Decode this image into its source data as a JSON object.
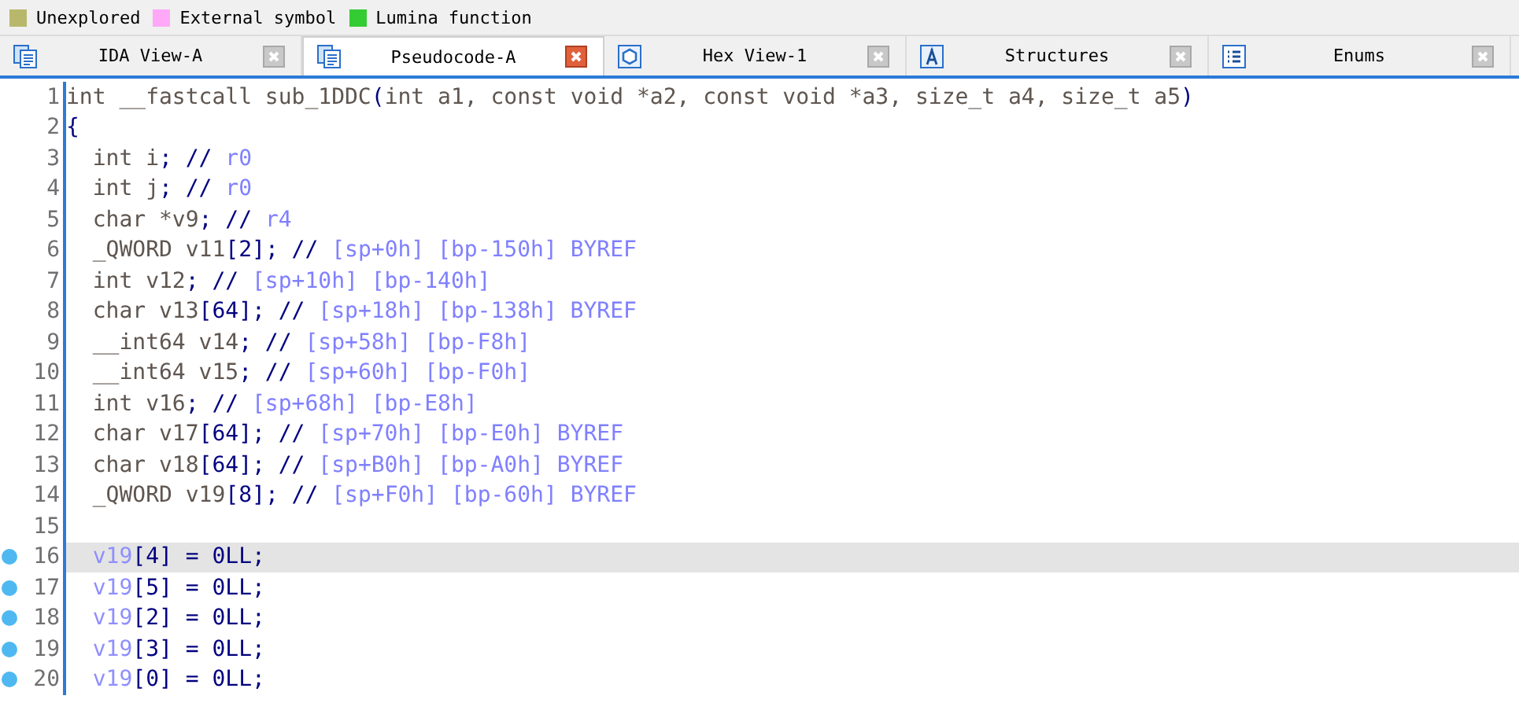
{
  "legend": [
    {
      "label": "Unexplored",
      "color": "#b8b86c"
    },
    {
      "label": "External symbol",
      "color": "#ffa8f8"
    },
    {
      "label": "Lumina function",
      "color": "#33cc33"
    }
  ],
  "tabs": [
    {
      "label": "IDA View-A",
      "kind": "listing",
      "selected": false
    },
    {
      "label": "Pseudocode-A",
      "kind": "listing",
      "selected": true
    },
    {
      "label": "Hex View-1",
      "kind": "hex",
      "selected": false
    },
    {
      "label": "Structures",
      "kind": "struct",
      "selected": false
    },
    {
      "label": "Enums",
      "kind": "enum",
      "selected": false
    }
  ],
  "lines": [
    {
      "number": "1",
      "breakpoint": false,
      "highlighted": false,
      "tokens": [
        {
          "kind": "plain",
          "text": "int __fastcall sub_1DDC"
        },
        {
          "kind": "punct",
          "text": "("
        },
        {
          "kind": "plain",
          "text": "int a1, const void *a2, const void *a3, size_t a4, size_t a5"
        },
        {
          "kind": "punct",
          "text": ")"
        }
      ]
    },
    {
      "number": "2",
      "breakpoint": false,
      "highlighted": false,
      "tokens": [
        {
          "kind": "punct",
          "text": "{"
        }
      ]
    },
    {
      "number": "3",
      "breakpoint": false,
      "highlighted": false,
      "tokens": [
        {
          "kind": "plain",
          "text": "  int i"
        },
        {
          "kind": "punct",
          "text": "; //"
        },
        {
          "kind": "comment",
          "text": " r0"
        }
      ]
    },
    {
      "number": "4",
      "breakpoint": false,
      "highlighted": false,
      "tokens": [
        {
          "kind": "plain",
          "text": "  int j"
        },
        {
          "kind": "punct",
          "text": "; //"
        },
        {
          "kind": "comment",
          "text": " r0"
        }
      ]
    },
    {
      "number": "5",
      "breakpoint": false,
      "highlighted": false,
      "tokens": [
        {
          "kind": "plain",
          "text": "  char *v9"
        },
        {
          "kind": "punct",
          "text": "; //"
        },
        {
          "kind": "comment",
          "text": " r4"
        }
      ]
    },
    {
      "number": "6",
      "breakpoint": false,
      "highlighted": false,
      "tokens": [
        {
          "kind": "plain",
          "text": "  _QWORD v11"
        },
        {
          "kind": "punct",
          "text": "[2]; //"
        },
        {
          "kind": "comment",
          "text": " [sp+0h] [bp-150h] BYREF"
        }
      ]
    },
    {
      "number": "7",
      "breakpoint": false,
      "highlighted": false,
      "tokens": [
        {
          "kind": "plain",
          "text": "  int v12"
        },
        {
          "kind": "punct",
          "text": "; //"
        },
        {
          "kind": "comment",
          "text": " [sp+10h] [bp-140h]"
        }
      ]
    },
    {
      "number": "8",
      "breakpoint": false,
      "highlighted": false,
      "tokens": [
        {
          "kind": "plain",
          "text": "  char v13"
        },
        {
          "kind": "punct",
          "text": "[64]; //"
        },
        {
          "kind": "comment",
          "text": " [sp+18h] [bp-138h] BYREF"
        }
      ]
    },
    {
      "number": "9",
      "breakpoint": false,
      "highlighted": false,
      "tokens": [
        {
          "kind": "plain",
          "text": "  __int64 v14"
        },
        {
          "kind": "punct",
          "text": "; //"
        },
        {
          "kind": "comment",
          "text": " [sp+58h] [bp-F8h]"
        }
      ]
    },
    {
      "number": "10",
      "breakpoint": false,
      "highlighted": false,
      "tokens": [
        {
          "kind": "plain",
          "text": "  __int64 v15"
        },
        {
          "kind": "punct",
          "text": "; //"
        },
        {
          "kind": "comment",
          "text": " [sp+60h] [bp-F0h]"
        }
      ]
    },
    {
      "number": "11",
      "breakpoint": false,
      "highlighted": false,
      "tokens": [
        {
          "kind": "plain",
          "text": "  int v16"
        },
        {
          "kind": "punct",
          "text": "; //"
        },
        {
          "kind": "comment",
          "text": " [sp+68h] [bp-E8h]"
        }
      ]
    },
    {
      "number": "12",
      "breakpoint": false,
      "highlighted": false,
      "tokens": [
        {
          "kind": "plain",
          "text": "  char v17"
        },
        {
          "kind": "punct",
          "text": "[64]; //"
        },
        {
          "kind": "comment",
          "text": " [sp+70h] [bp-E0h] BYREF"
        }
      ]
    },
    {
      "number": "13",
      "breakpoint": false,
      "highlighted": false,
      "tokens": [
        {
          "kind": "plain",
          "text": "  char v18"
        },
        {
          "kind": "punct",
          "text": "[64]; //"
        },
        {
          "kind": "comment",
          "text": " [sp+B0h] [bp-A0h] BYREF"
        }
      ]
    },
    {
      "number": "14",
      "breakpoint": false,
      "highlighted": false,
      "tokens": [
        {
          "kind": "plain",
          "text": "  _QWORD v19"
        },
        {
          "kind": "punct",
          "text": "[8]; //"
        },
        {
          "kind": "comment",
          "text": " [sp+F0h] [bp-60h] BYREF"
        }
      ]
    },
    {
      "number": "15",
      "breakpoint": false,
      "highlighted": false
    },
    {
      "number": "16",
      "breakpoint": true,
      "highlighted": true,
      "tokens": [
        {
          "kind": "var",
          "text": "  v19"
        },
        {
          "kind": "punct",
          "text": "[4] = 0LL;"
        }
      ]
    },
    {
      "number": "17",
      "breakpoint": true,
      "highlighted": false,
      "tokens": [
        {
          "kind": "var",
          "text": "  v19"
        },
        {
          "kind": "punct",
          "text": "[5] = 0LL;"
        }
      ]
    },
    {
      "number": "18",
      "breakpoint": true,
      "highlighted": false,
      "tokens": [
        {
          "kind": "var",
          "text": "  v19"
        },
        {
          "kind": "punct",
          "text": "[2] = 0LL;"
        }
      ]
    },
    {
      "number": "19",
      "breakpoint": true,
      "highlighted": false,
      "tokens": [
        {
          "kind": "var",
          "text": "  v19"
        },
        {
          "kind": "punct",
          "text": "[3] = 0LL;"
        }
      ]
    },
    {
      "number": "20",
      "breakpoint": true,
      "highlighted": false,
      "tokens": [
        {
          "kind": "var",
          "text": "  v19"
        },
        {
          "kind": "punct",
          "text": "[0] = 0LL;"
        }
      ]
    }
  ]
}
